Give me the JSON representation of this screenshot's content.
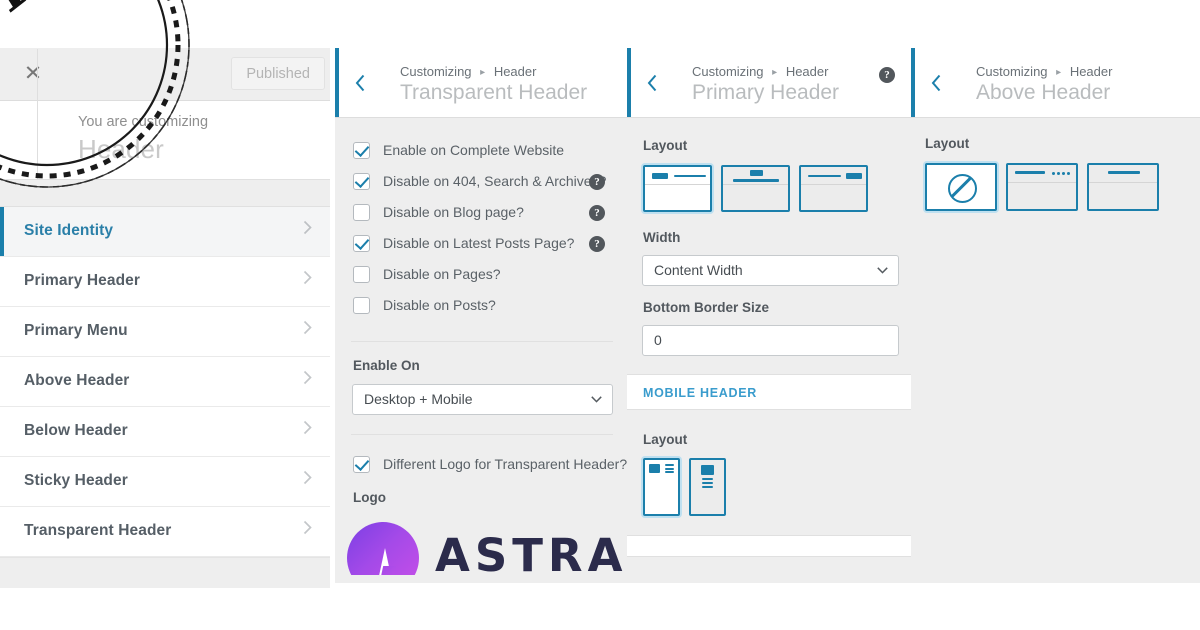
{
  "app": {
    "close_icon": "close-x-icon",
    "publish_button": "Published",
    "you_are_customizing": "You are customizing",
    "customizing_target": "Header",
    "accent_blue": "#1b7fab",
    "link_blue": "#2a7fa8",
    "panel_bg": "#eeeeee"
  },
  "sidebar": {
    "items": [
      {
        "label": "Site Identity",
        "active": true
      },
      {
        "label": "Primary Header",
        "active": false
      },
      {
        "label": "Primary Menu",
        "active": false
      },
      {
        "label": "Above Header",
        "active": false
      },
      {
        "label": "Below Header",
        "active": false
      },
      {
        "label": "Sticky Header",
        "active": false
      },
      {
        "label": "Transparent Header",
        "active": false
      }
    ]
  },
  "panel_transparent": {
    "breadcrumb_root": "Customizing",
    "breadcrumb_leaf": "Header",
    "title": "Transparent Header",
    "checkboxes": [
      {
        "label": "Enable on Complete Website",
        "checked": true,
        "help": false
      },
      {
        "label": "Disable on 404, Search & Archives?",
        "checked": true,
        "help": true
      },
      {
        "label": "Disable on Blog page?",
        "checked": false,
        "help": true
      },
      {
        "label": "Disable on Latest Posts Page?",
        "checked": true,
        "help": true
      },
      {
        "label": "Disable on Pages?",
        "checked": false,
        "help": false
      },
      {
        "label": "Disable on Posts?",
        "checked": false,
        "help": false
      }
    ],
    "enable_on_label": "Enable On",
    "enable_on_value": "Desktop + Mobile",
    "different_logo_label": "Different Logo for Transparent Header?",
    "different_logo_checked": true,
    "logo_label": "Logo",
    "logo_text": "ASTRA"
  },
  "panel_primary": {
    "breadcrumb_root": "Customizing",
    "breadcrumb_leaf": "Header",
    "title": "Primary Header",
    "has_help": true,
    "layout_label": "Layout",
    "layout_selected_index": 0,
    "width_label": "Width",
    "width_value": "Content Width",
    "bottom_border_label": "Bottom Border Size",
    "bottom_border_value": "0",
    "mobile_section_title": "MOBILE HEADER",
    "mobile_layout_label": "Layout",
    "mobile_layout_selected_index": 0
  },
  "panel_above": {
    "breadcrumb_root": "Customizing",
    "breadcrumb_leaf": "Header",
    "title": "Above Header",
    "layout_label": "Layout",
    "layout_selected_index": 0
  },
  "watermark": {
    "text": "ASTRA"
  }
}
